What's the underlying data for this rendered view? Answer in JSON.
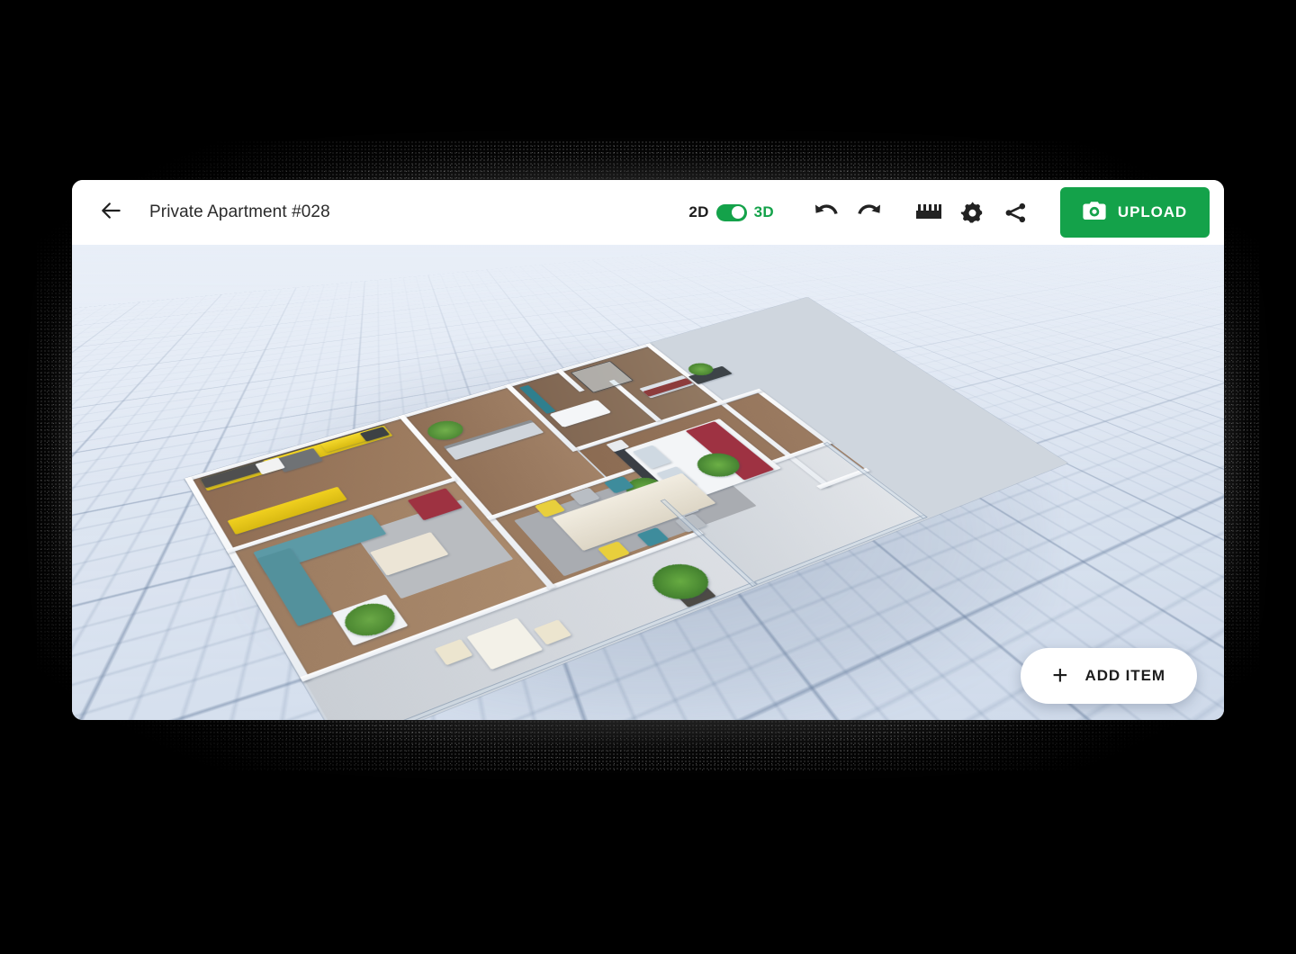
{
  "header": {
    "back_icon": "arrow-left-icon",
    "title": "Private Apartment #028",
    "view_toggle": {
      "label_2d": "2D",
      "label_3d": "3D",
      "active": "3D",
      "accent_color": "#14a24a"
    },
    "tools": [
      {
        "name": "undo-icon",
        "tooltip": "Undo"
      },
      {
        "name": "redo-icon",
        "tooltip": "Redo"
      },
      {
        "name": "ruler-icon",
        "tooltip": "Measure"
      },
      {
        "name": "gear-icon",
        "tooltip": "Settings"
      },
      {
        "name": "share-icon",
        "tooltip": "Share"
      }
    ],
    "upload_button": {
      "label": "UPLOAD",
      "icon": "camera-icon",
      "background": "#14a24a",
      "text_color": "#ffffff"
    }
  },
  "viewport": {
    "mode": "3D",
    "background_color": "#dee6f2",
    "grid_visible": true,
    "scene_name": "apartment-floorplan-3d",
    "rooms": [
      {
        "name": "kitchen",
        "accent": "#f0d01f"
      },
      {
        "name": "living-room",
        "accent": "#5c9aa6"
      },
      {
        "name": "hallway",
        "accent": "#cfd5dc"
      },
      {
        "name": "bathroom",
        "accent": "#2f7f8e"
      },
      {
        "name": "bedroom",
        "accent": "#9e3242"
      },
      {
        "name": "dining-room",
        "accent": "#e8cf3c"
      },
      {
        "name": "balcony",
        "accent": "#cdd4dc"
      },
      {
        "name": "terrace",
        "accent": "#d6dbe1"
      }
    ]
  },
  "add_item_button": {
    "label": "ADD ITEM",
    "icon": "plus-icon"
  },
  "colors": {
    "brand_green": "#14a24a",
    "card_background": "#ffffff",
    "page_background": "#000000",
    "title_text": "#2b2b2b",
    "icon_dark": "#1f1f1f"
  }
}
